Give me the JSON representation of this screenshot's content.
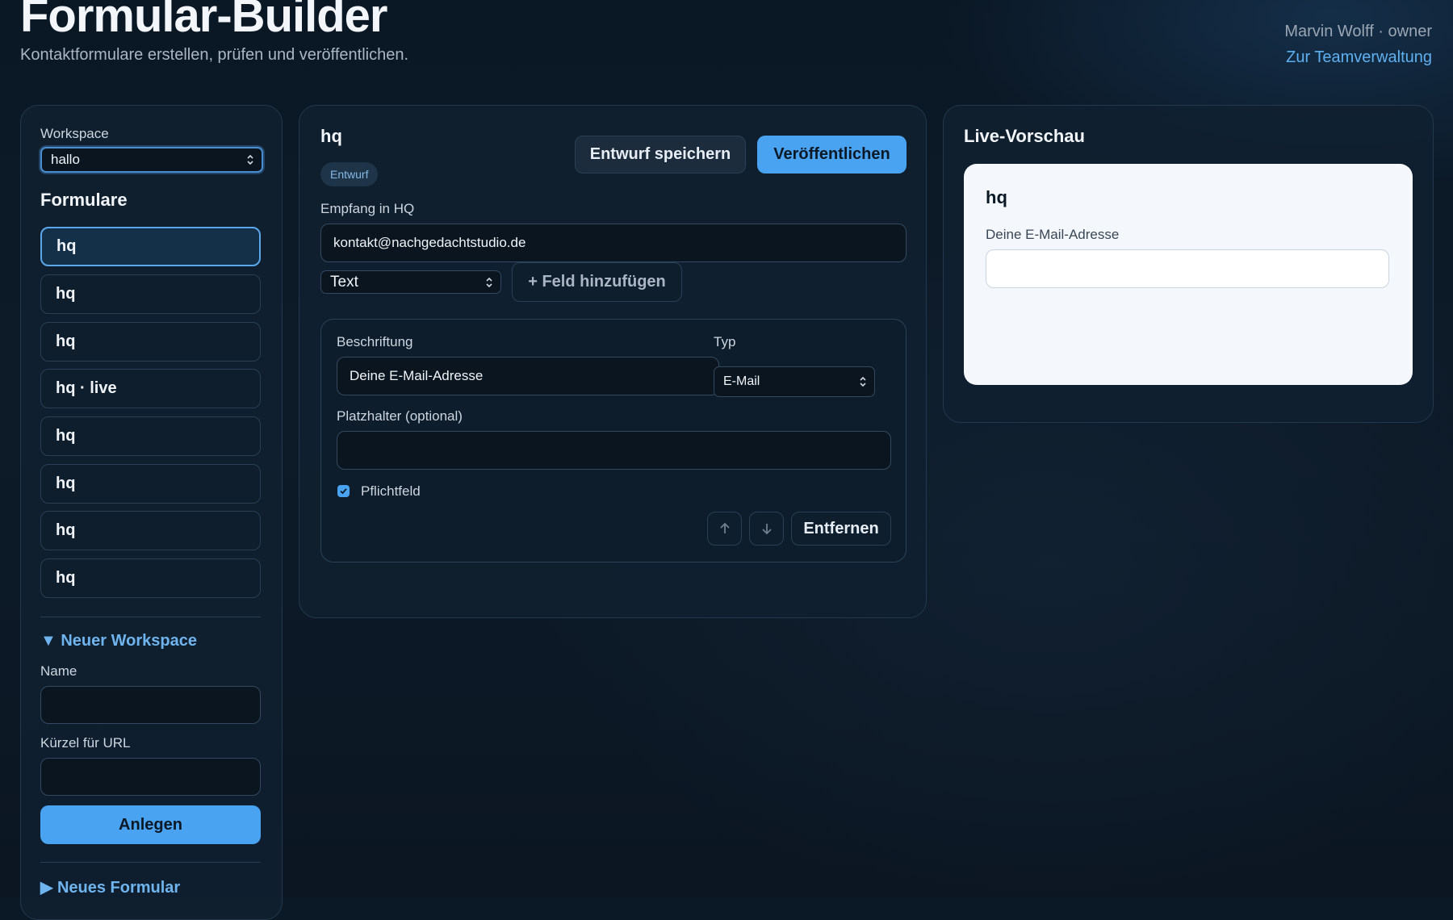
{
  "header": {
    "title": "Formular-Builder",
    "subtitle": "Kontaktformulare erstellen, prüfen und veröffentlichen.",
    "user": "Marvin Wolff · owner",
    "team_link": "Zur Teamverwaltung"
  },
  "sidebar": {
    "workspace_label": "Workspace",
    "workspace_value": "hallo",
    "forms_heading": "Formulare",
    "forms": [
      {
        "label": "hq"
      },
      {
        "label": "hq"
      },
      {
        "label": "hq"
      },
      {
        "label": "hq · live"
      },
      {
        "label": "hq"
      },
      {
        "label": "hq"
      },
      {
        "label": "hq"
      },
      {
        "label": "hq"
      }
    ],
    "new_workspace": {
      "toggle": "▼ Neuer Workspace",
      "name_label": "Name",
      "name_value": "",
      "slug_label": "Kürzel für URL",
      "slug_value": "",
      "create_button": "Anlegen"
    },
    "new_form_toggle": "▶ Neues Formular"
  },
  "editor": {
    "form_name": "hq",
    "status_badge": "Entwurf",
    "save_draft_button": "Entwurf speichern",
    "publish_button": "Veröffentlichen",
    "recipient_label": "Empfang in HQ",
    "recipient_value": "kontakt@nachgedachtstudio.de",
    "field_type_value": "Text",
    "add_field_button": "+ Feld hinzufügen",
    "field": {
      "label_caption": "Beschriftung",
      "label_value": "Deine E-Mail-Adresse",
      "type_caption": "Typ",
      "type_value": "E-Mail",
      "placeholder_caption": "Platzhalter (optional)",
      "placeholder_value": "",
      "required_label": "Pflichtfeld",
      "required": true,
      "remove_button": "Entfernen"
    }
  },
  "preview": {
    "heading": "Live-Vorschau",
    "form_title": "hq",
    "field_label": "Deine E-Mail-Adresse",
    "field_value": ""
  },
  "colors": {
    "background": "#0b1825",
    "panel": "#102030",
    "accent": "#4aa3f0",
    "link": "#5fb0f0",
    "preview_card": "#f4f8fc"
  }
}
